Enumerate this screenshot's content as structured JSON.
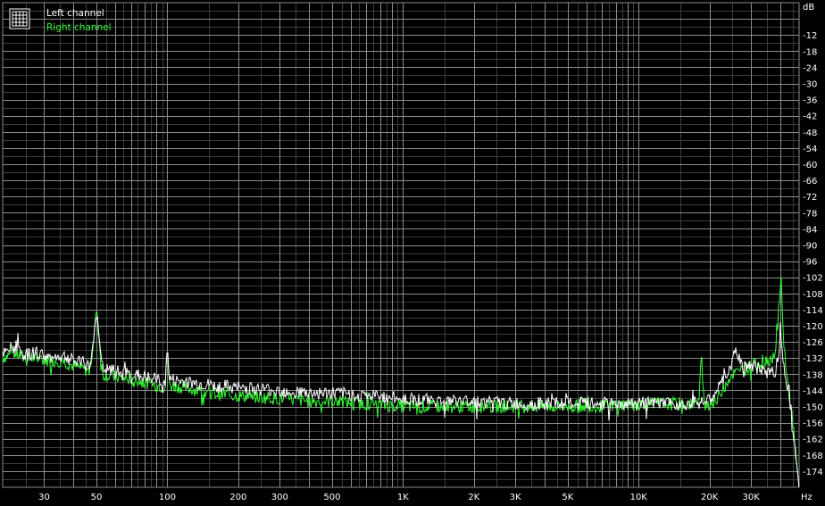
{
  "legend": {
    "icon": "spectrum-grid-icon",
    "items": [
      {
        "label": "Left channel",
        "color": "#ffffff"
      },
      {
        "label": "Right channel",
        "color": "#33ff33"
      }
    ]
  },
  "colors": {
    "background": "#000000",
    "grid_major": "#8c8c8c",
    "grid_minor": "#3d3d3d",
    "text": "#ffffff"
  },
  "chart_data": {
    "type": "line",
    "xscale": "log",
    "xlim": [
      20,
      48000
    ],
    "ylim": [
      -180,
      0
    ],
    "x_unit": "Hz",
    "y_unit": "dB",
    "grid": true,
    "legend_position": "top-left",
    "x_ticks": [
      {
        "value": 30,
        "label": "30"
      },
      {
        "value": 50,
        "label": "50"
      },
      {
        "value": 100,
        "label": "100"
      },
      {
        "value": 200,
        "label": "200"
      },
      {
        "value": 300,
        "label": "300"
      },
      {
        "value": 500,
        "label": "500"
      },
      {
        "value": 1000,
        "label": "1K"
      },
      {
        "value": 2000,
        "label": "2K"
      },
      {
        "value": 3000,
        "label": "3K"
      },
      {
        "value": 5000,
        "label": "5K"
      },
      {
        "value": 10000,
        "label": "10K"
      },
      {
        "value": 20000,
        "label": "20K"
      },
      {
        "value": 30000,
        "label": "30K"
      }
    ],
    "y_ticks": [
      -12,
      -18,
      -24,
      -30,
      -36,
      -42,
      -48,
      -54,
      -60,
      -66,
      -72,
      -78,
      -84,
      -90,
      -96,
      -102,
      -108,
      -114,
      -120,
      -126,
      -132,
      -138,
      -144,
      -150,
      -156,
      -162,
      -168,
      -174
    ],
    "series": [
      {
        "name": "Left channel",
        "color": "#ffffff",
        "points": [
          [
            20,
            -131
          ],
          [
            22,
            -128
          ],
          [
            25,
            -131
          ],
          [
            28,
            -130
          ],
          [
            32,
            -132
          ],
          [
            36,
            -131
          ],
          [
            40,
            -133
          ],
          [
            44,
            -134
          ],
          [
            47,
            -135
          ],
          [
            49,
            -123
          ],
          [
            50,
            -115
          ],
          [
            51,
            -123
          ],
          [
            53,
            -136
          ],
          [
            60,
            -137
          ],
          [
            70,
            -138
          ],
          [
            80,
            -139
          ],
          [
            90,
            -140
          ],
          [
            98,
            -141
          ],
          [
            100,
            -128
          ],
          [
            102,
            -140
          ],
          [
            120,
            -141
          ],
          [
            150,
            -142
          ],
          [
            200,
            -143
          ],
          [
            300,
            -144
          ],
          [
            400,
            -145
          ],
          [
            500,
            -145
          ],
          [
            700,
            -146
          ],
          [
            1000,
            -147
          ],
          [
            1500,
            -148
          ],
          [
            2000,
            -148
          ],
          [
            3000,
            -149
          ],
          [
            5000,
            -149
          ],
          [
            7000,
            -149
          ],
          [
            10000,
            -149
          ],
          [
            15000,
            -149
          ],
          [
            20000,
            -148
          ],
          [
            23000,
            -140
          ],
          [
            25000,
            -134
          ],
          [
            26000,
            -129
          ],
          [
            27000,
            -134
          ],
          [
            30000,
            -135
          ],
          [
            35000,
            -137
          ],
          [
            38000,
            -137
          ],
          [
            39500,
            -130
          ],
          [
            40000,
            -120
          ],
          [
            40500,
            -128
          ],
          [
            42000,
            -138
          ],
          [
            44000,
            -147
          ],
          [
            46000,
            -165
          ],
          [
            48000,
            -180
          ]
        ]
      },
      {
        "name": "Right channel",
        "color": "#33ff33",
        "points": [
          [
            20,
            -132
          ],
          [
            22,
            -130
          ],
          [
            25,
            -132
          ],
          [
            28,
            -132
          ],
          [
            32,
            -133
          ],
          [
            36,
            -133
          ],
          [
            40,
            -135
          ],
          [
            44,
            -136
          ],
          [
            47,
            -137
          ],
          [
            49,
            -122
          ],
          [
            50,
            -114
          ],
          [
            51,
            -122
          ],
          [
            53,
            -138
          ],
          [
            60,
            -139
          ],
          [
            70,
            -140
          ],
          [
            80,
            -141
          ],
          [
            90,
            -142
          ],
          [
            98,
            -143
          ],
          [
            100,
            -128
          ],
          [
            102,
            -142
          ],
          [
            120,
            -143
          ],
          [
            150,
            -145
          ],
          [
            200,
            -146
          ],
          [
            300,
            -147
          ],
          [
            400,
            -148
          ],
          [
            500,
            -148
          ],
          [
            700,
            -149
          ],
          [
            1000,
            -150
          ],
          [
            1500,
            -150
          ],
          [
            2000,
            -150
          ],
          [
            3000,
            -150
          ],
          [
            5000,
            -150
          ],
          [
            7000,
            -150
          ],
          [
            10000,
            -149
          ],
          [
            15000,
            -149
          ],
          [
            18000,
            -149
          ],
          [
            18500,
            -131
          ],
          [
            19000,
            -149
          ],
          [
            20000,
            -149
          ],
          [
            21500,
            -148
          ],
          [
            23000,
            -142
          ],
          [
            25000,
            -138
          ],
          [
            27000,
            -137
          ],
          [
            30000,
            -135
          ],
          [
            35000,
            -133
          ],
          [
            38000,
            -131
          ],
          [
            39000,
            -118
          ],
          [
            39800,
            -110
          ],
          [
            40200,
            -100
          ],
          [
            40600,
            -112
          ],
          [
            41500,
            -128
          ],
          [
            43000,
            -142
          ],
          [
            45000,
            -155
          ],
          [
            46500,
            -168
          ],
          [
            48000,
            -180
          ]
        ]
      }
    ]
  }
}
